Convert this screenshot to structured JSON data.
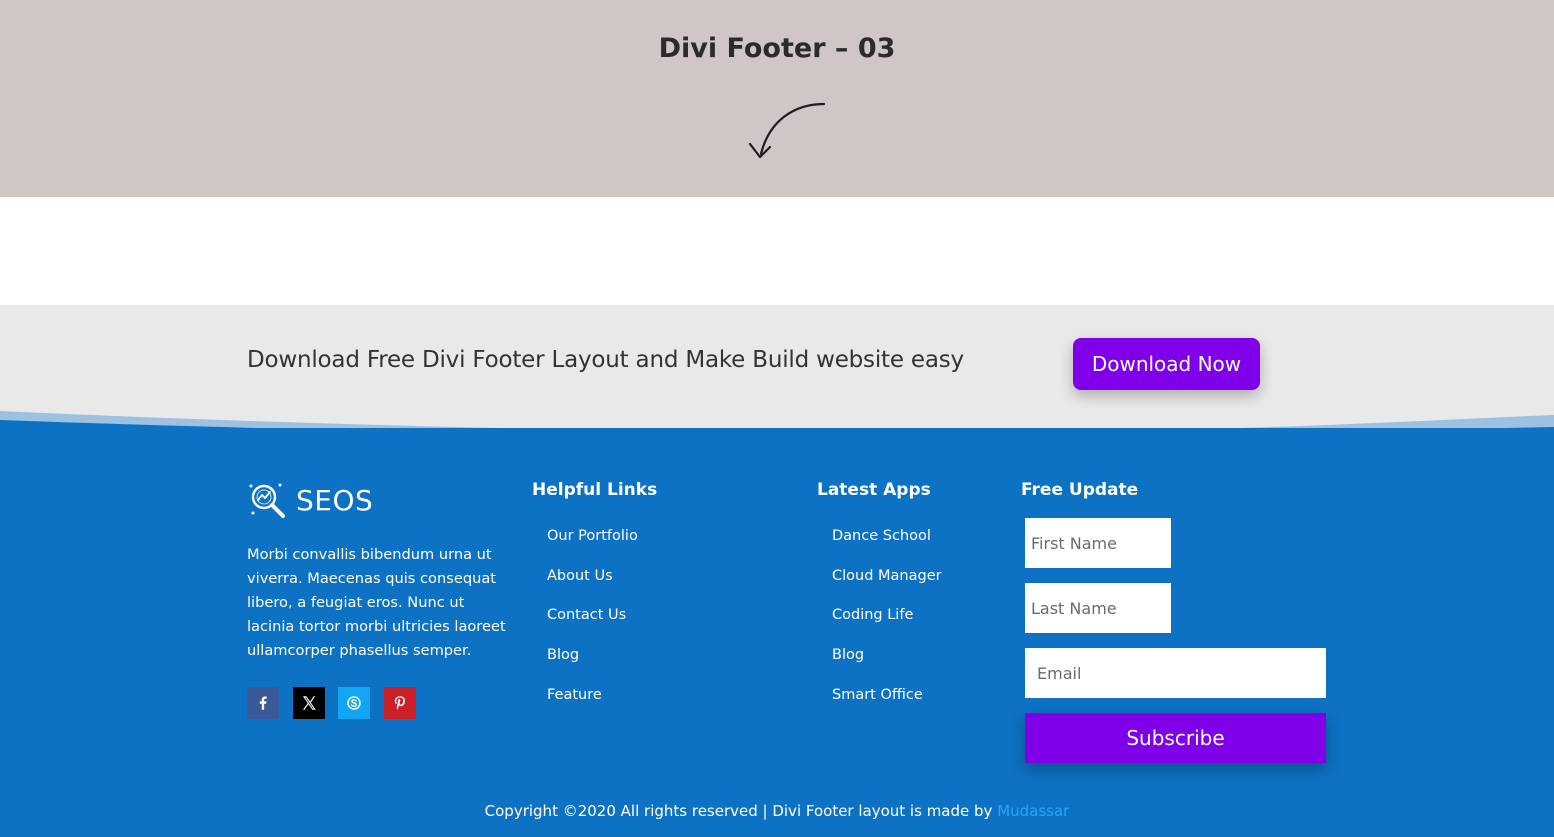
{
  "hero": {
    "title": "Divi Footer – 03"
  },
  "cta": {
    "text": "Download Free Divi Footer Layout and Make Build website easy",
    "button_label": "Download Now"
  },
  "brand": {
    "name": "SEOS",
    "description": "Morbi convallis bibendum urna ut viverra. Maecenas quis consequat libero, a feugiat eros. Nunc ut lacinia tortor morbi ultricies laoreet ullamcorper phasellus semper."
  },
  "socials": [
    {
      "name": "facebook-icon",
      "color": "#3b5998"
    },
    {
      "name": "x-icon",
      "color": "#000000"
    },
    {
      "name": "skype-icon",
      "color": "#12a5f4"
    },
    {
      "name": "pinterest-icon",
      "color": "#cb2027"
    }
  ],
  "helpful_links": {
    "title": "Helpful Links",
    "items": [
      "Our Portfolio",
      "About Us",
      "Contact Us",
      "Blog",
      "Feature"
    ]
  },
  "latest_apps": {
    "title": "Latest Apps",
    "items": [
      "Dance School",
      "Cloud Manager",
      "Coding Life",
      "Blog",
      "Smart Office"
    ]
  },
  "free_update": {
    "title": "Free Update",
    "first_name_placeholder": "First Name",
    "last_name_placeholder": "Last Name",
    "email_placeholder": "Email",
    "subscribe_label": "Subscribe"
  },
  "copyright": {
    "text": "Copyright ©2020 All rights reserved | Divi Footer layout is made by ",
    "author": "Mudassar"
  },
  "colors": {
    "hero_bg": "#d0c6c5",
    "cta_bg": "#e9e9e9",
    "footer_bg": "#0d72c4",
    "accent": "#7f00e8",
    "link": "#2ea3f2"
  }
}
